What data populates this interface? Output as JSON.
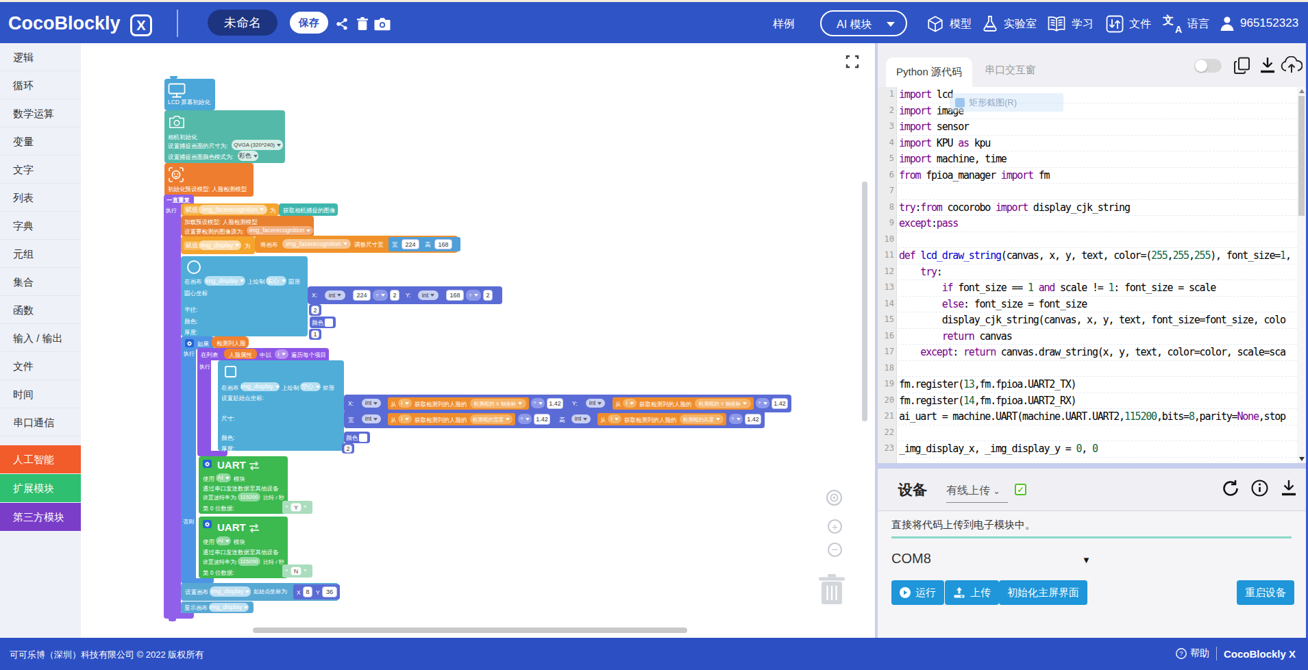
{
  "topbar": {
    "logo": "CocoBlockly",
    "logo_x": "X",
    "untitled": "未命名",
    "save": "保存",
    "examples": "样例",
    "module_select": "AI 模块",
    "nav_model": "模型",
    "nav_lab": "实验室",
    "nav_learn": "学习",
    "nav_file": "文件",
    "nav_lang": "语言",
    "lang_glyph": "文",
    "lang_glyph2": "A",
    "user": "965152323"
  },
  "sidebar": {
    "items": [
      "逻辑",
      "循环",
      "数学运算",
      "变量",
      "文字",
      "列表",
      "字典",
      "元组",
      "集合",
      "函数",
      "输入 / 输出",
      "文件",
      "时间",
      "串口通信"
    ],
    "special": [
      {
        "label": "人工智能",
        "color": "#f25b2a"
      },
      {
        "label": "扩展模块",
        "color": "#2fbf71"
      },
      {
        "label": "第三方模块",
        "color": "#7a3dc8"
      }
    ]
  },
  "workspace": {
    "lcd_init": "LCD 屏幕初始化",
    "cam_init": "相机初始化",
    "cam_size_label": "设置捕捉画面的尺寸为:",
    "cam_size_value": "QVGA (320*240)",
    "cam_color_label": "设置捕捉画面颜色模式为:",
    "cam_color_value": "彩色",
    "face_model_init": "初始化预设模型: 人脸检测模型",
    "repeat_forever": "一直重复",
    "do_label": "执行",
    "assign": "赋值",
    "var_img_facerecognition": "img_facerecognition",
    "to": "为",
    "get_camera_image": "获取相机捕捉的图像",
    "load_model": "加载预设模型: 人脸检测模型",
    "set_detect_source": "设置要检测的图像源为:",
    "var_img_display": "img_display",
    "resize_canvas_1": "将画布",
    "resize_canvas_2": "调整尺寸至",
    "width_label": "宽",
    "w224": "224",
    "height_label": "高",
    "h168": "168",
    "draw_on_canvas": "在画布",
    "draw_verb": "上绘制",
    "solid": "实心",
    "circle_label": "圆形",
    "hollow": "空心",
    "rect_label": "矩形",
    "center_label": "圆心坐标",
    "x_label": "X:",
    "y_label": "Y:",
    "int_label": "int",
    "div": "÷",
    "two": "2",
    "one": "1",
    "radius_label": "半径:",
    "color_label": "颜色:",
    "color_chip": "颜色",
    "thick_label": "厚度:",
    "if_label": "如果",
    "detected_face": "检测到人脸",
    "else_label": "否则",
    "for_in_list": "在列表",
    "face_attrs": "人脸属性",
    "for_with": "中以",
    "var_i": "i",
    "for_each": "遍历每个项目",
    "set_start_label": "设置起始点坐标:",
    "size_label": "尺寸:",
    "from_label": "从",
    "get_face_attr": "获取检测到的人脸的",
    "attr_x": "检测框的 X 轴坐标",
    "attr_y": "检测框的 Y 轴坐标",
    "attr_w": "检测框的宽度",
    "attr_h": "检测框的高度",
    "f142": "1.42",
    "uart_title": "UART",
    "uart_use": "使用",
    "uart_ai": "AI",
    "uart_module": "模块",
    "uart_send": "通过串口发送数据至其他设备",
    "uart_baud_1": "设置波特率为:",
    "uart_baud": "115200",
    "uart_baud_2": "比特 / 秒",
    "uart_data0": "第 0 位数据:",
    "quote_open": "“",
    "quote_close": "”",
    "str_y": "Y",
    "str_n": "N",
    "set_canvas_origin_1": "设置画布",
    "set_canvas_origin_2": "起始点坐标为:",
    "x_short": "X",
    "y_short": "Y",
    "x8": "8",
    "y36": "36",
    "show_canvas": "显示画布"
  },
  "code_panel": {
    "tab_active": "Python 源代码",
    "tab_inactive": "串口交互窗",
    "tooltip": "矩形截图(R)",
    "lines": [
      {
        "n": "1",
        "t": [
          [
            "k",
            "import"
          ],
          [
            "p",
            " lcd"
          ]
        ]
      },
      {
        "n": "2",
        "t": [
          [
            "k",
            "import"
          ],
          [
            "p",
            " image"
          ]
        ]
      },
      {
        "n": "3",
        "t": [
          [
            "k",
            "import"
          ],
          [
            "p",
            " sensor"
          ]
        ]
      },
      {
        "n": "4",
        "t": [
          [
            "k",
            "import"
          ],
          [
            "p",
            " KPU "
          ],
          [
            "k",
            "as"
          ],
          [
            "p",
            " kpu"
          ]
        ]
      },
      {
        "n": "5",
        "t": [
          [
            "k",
            "import"
          ],
          [
            "p",
            " machine, time"
          ]
        ]
      },
      {
        "n": "6",
        "t": [
          [
            "k",
            "from"
          ],
          [
            "p",
            " fpioa_manager "
          ],
          [
            "k",
            "import"
          ],
          [
            "p",
            " fm"
          ]
        ]
      },
      {
        "n": "7",
        "t": []
      },
      {
        "n": "8",
        "t": [
          [
            "k",
            "try"
          ],
          [
            "p",
            ":"
          ],
          [
            "k",
            "from"
          ],
          [
            "p",
            " cocorobo "
          ],
          [
            "k",
            "import"
          ],
          [
            "p",
            " display_cjk_string"
          ]
        ]
      },
      {
        "n": "9",
        "t": [
          [
            "k",
            "except"
          ],
          [
            "p",
            ":"
          ],
          [
            "k",
            "pass"
          ]
        ]
      },
      {
        "n": "10",
        "t": []
      },
      {
        "n": "11",
        "t": [
          [
            "k",
            "def"
          ],
          [
            "p",
            " "
          ],
          [
            "d",
            "lcd_draw_string"
          ],
          [
            "p",
            "(canvas, x, y, text, color=("
          ],
          [
            "n2",
            "255"
          ],
          [
            "p",
            ","
          ],
          [
            "n2",
            "255"
          ],
          [
            "p",
            ","
          ],
          [
            "n2",
            "255"
          ],
          [
            "p",
            "), font_size="
          ],
          [
            "n2",
            "1"
          ],
          [
            "p",
            ","
          ]
        ]
      },
      {
        "n": "12",
        "t": [
          [
            "p",
            "    "
          ],
          [
            "k",
            "try"
          ],
          [
            "p",
            ":"
          ]
        ]
      },
      {
        "n": "13",
        "t": [
          [
            "p",
            "        "
          ],
          [
            "k",
            "if"
          ],
          [
            "p",
            " font_size == "
          ],
          [
            "n2",
            "1"
          ],
          [
            "p",
            " "
          ],
          [
            "k",
            "and"
          ],
          [
            "p",
            " scale != "
          ],
          [
            "n2",
            "1"
          ],
          [
            "p",
            ": font_size = scale"
          ]
        ]
      },
      {
        "n": "14",
        "t": [
          [
            "p",
            "        "
          ],
          [
            "k",
            "else"
          ],
          [
            "p",
            ": font_size = font_size"
          ]
        ]
      },
      {
        "n": "15",
        "t": [
          [
            "p",
            "        display_cjk_string(canvas, x, y, text, font_size=font_size, colo"
          ]
        ]
      },
      {
        "n": "16",
        "t": [
          [
            "p",
            "        "
          ],
          [
            "k",
            "return"
          ],
          [
            "p",
            " canvas"
          ]
        ]
      },
      {
        "n": "17",
        "t": [
          [
            "p",
            "    "
          ],
          [
            "k",
            "except"
          ],
          [
            "p",
            ": "
          ],
          [
            "k",
            "return"
          ],
          [
            "p",
            " canvas.draw_string(x, y, text, color=color, scale=sca"
          ]
        ]
      },
      {
        "n": "18",
        "t": []
      },
      {
        "n": "19",
        "t": [
          [
            "p",
            "fm.register("
          ],
          [
            "n2",
            "13"
          ],
          [
            "p",
            ",fm.fpioa.UART2_TX)"
          ]
        ]
      },
      {
        "n": "20",
        "t": [
          [
            "p",
            "fm.register("
          ],
          [
            "n2",
            "14"
          ],
          [
            "p",
            ",fm.fpioa.UART2_RX)"
          ]
        ]
      },
      {
        "n": "21",
        "t": [
          [
            "p",
            "ai_uart = machine.UART(machine.UART.UART2,"
          ],
          [
            "n2",
            "115200"
          ],
          [
            "p",
            ",bits="
          ],
          [
            "n2",
            "8"
          ],
          [
            "p",
            ",parity="
          ],
          [
            "k",
            "None"
          ],
          [
            "p",
            ",stop"
          ]
        ]
      },
      {
        "n": "22",
        "t": []
      },
      {
        "n": "23",
        "t": [
          [
            "p",
            "_img_display_x, _img_display_y = "
          ],
          [
            "n2",
            "0"
          ],
          [
            "p",
            ", "
          ],
          [
            "n2",
            "0"
          ]
        ]
      }
    ]
  },
  "device_panel": {
    "title": "设备",
    "mode": "有线上传",
    "check": "✓",
    "desc": "直接将代码上传到电子模块中。",
    "port": "COM8",
    "port_caret": "▼",
    "run": "运行",
    "upload": "上传",
    "init_screen": "初始化主屏界面",
    "restart": "重启设备"
  },
  "footer": {
    "copyright": "可可乐博（深圳）科技有限公司 © 2022 版权所有",
    "help": "帮助",
    "brand": "CocoBlockly X"
  }
}
